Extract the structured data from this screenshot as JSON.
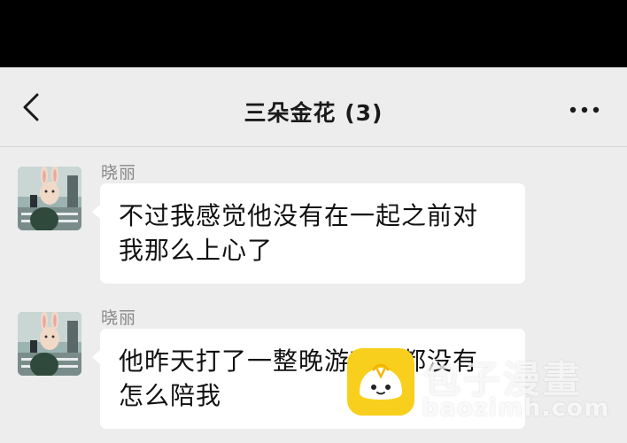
{
  "header": {
    "title": "三朵金花 (3)",
    "back_icon": "chevron-left-icon",
    "more_icon": "more-horizontal-icon"
  },
  "messages": [
    {
      "sender": "晓丽",
      "lines": [
        "不过我感觉他没有在一起之前对",
        "我那么上心了"
      ]
    },
    {
      "sender": "晓丽",
      "lines": [
        "他昨天打了一整晚游戏，都没有",
        "怎么陪我"
      ]
    }
  ],
  "watermark": {
    "brand": "包子漫畫",
    "url": "baozimh.com"
  },
  "colors": {
    "background": "#ededed",
    "bubble": "#ffffff",
    "status_bar": "#000000",
    "logo": "#f8cf1c"
  }
}
